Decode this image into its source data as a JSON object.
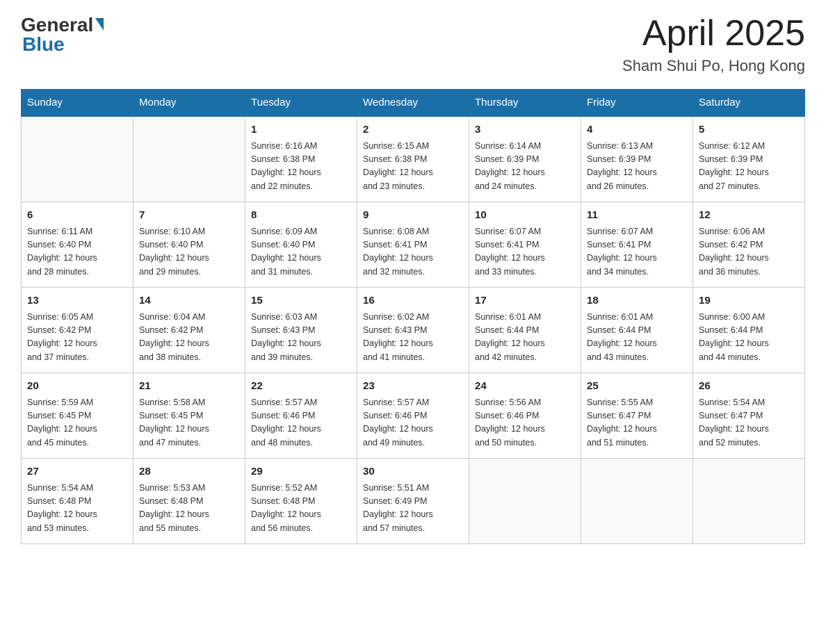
{
  "header": {
    "logo_general": "General",
    "logo_blue": "Blue",
    "title": "April 2025",
    "subtitle": "Sham Shui Po, Hong Kong"
  },
  "weekdays": [
    "Sunday",
    "Monday",
    "Tuesday",
    "Wednesday",
    "Thursday",
    "Friday",
    "Saturday"
  ],
  "weeks": [
    [
      {
        "day": "",
        "info": ""
      },
      {
        "day": "",
        "info": ""
      },
      {
        "day": "1",
        "info": "Sunrise: 6:16 AM\nSunset: 6:38 PM\nDaylight: 12 hours\nand 22 minutes."
      },
      {
        "day": "2",
        "info": "Sunrise: 6:15 AM\nSunset: 6:38 PM\nDaylight: 12 hours\nand 23 minutes."
      },
      {
        "day": "3",
        "info": "Sunrise: 6:14 AM\nSunset: 6:39 PM\nDaylight: 12 hours\nand 24 minutes."
      },
      {
        "day": "4",
        "info": "Sunrise: 6:13 AM\nSunset: 6:39 PM\nDaylight: 12 hours\nand 26 minutes."
      },
      {
        "day": "5",
        "info": "Sunrise: 6:12 AM\nSunset: 6:39 PM\nDaylight: 12 hours\nand 27 minutes."
      }
    ],
    [
      {
        "day": "6",
        "info": "Sunrise: 6:11 AM\nSunset: 6:40 PM\nDaylight: 12 hours\nand 28 minutes."
      },
      {
        "day": "7",
        "info": "Sunrise: 6:10 AM\nSunset: 6:40 PM\nDaylight: 12 hours\nand 29 minutes."
      },
      {
        "day": "8",
        "info": "Sunrise: 6:09 AM\nSunset: 6:40 PM\nDaylight: 12 hours\nand 31 minutes."
      },
      {
        "day": "9",
        "info": "Sunrise: 6:08 AM\nSunset: 6:41 PM\nDaylight: 12 hours\nand 32 minutes."
      },
      {
        "day": "10",
        "info": "Sunrise: 6:07 AM\nSunset: 6:41 PM\nDaylight: 12 hours\nand 33 minutes."
      },
      {
        "day": "11",
        "info": "Sunrise: 6:07 AM\nSunset: 6:41 PM\nDaylight: 12 hours\nand 34 minutes."
      },
      {
        "day": "12",
        "info": "Sunrise: 6:06 AM\nSunset: 6:42 PM\nDaylight: 12 hours\nand 36 minutes."
      }
    ],
    [
      {
        "day": "13",
        "info": "Sunrise: 6:05 AM\nSunset: 6:42 PM\nDaylight: 12 hours\nand 37 minutes."
      },
      {
        "day": "14",
        "info": "Sunrise: 6:04 AM\nSunset: 6:42 PM\nDaylight: 12 hours\nand 38 minutes."
      },
      {
        "day": "15",
        "info": "Sunrise: 6:03 AM\nSunset: 6:43 PM\nDaylight: 12 hours\nand 39 minutes."
      },
      {
        "day": "16",
        "info": "Sunrise: 6:02 AM\nSunset: 6:43 PM\nDaylight: 12 hours\nand 41 minutes."
      },
      {
        "day": "17",
        "info": "Sunrise: 6:01 AM\nSunset: 6:44 PM\nDaylight: 12 hours\nand 42 minutes."
      },
      {
        "day": "18",
        "info": "Sunrise: 6:01 AM\nSunset: 6:44 PM\nDaylight: 12 hours\nand 43 minutes."
      },
      {
        "day": "19",
        "info": "Sunrise: 6:00 AM\nSunset: 6:44 PM\nDaylight: 12 hours\nand 44 minutes."
      }
    ],
    [
      {
        "day": "20",
        "info": "Sunrise: 5:59 AM\nSunset: 6:45 PM\nDaylight: 12 hours\nand 45 minutes."
      },
      {
        "day": "21",
        "info": "Sunrise: 5:58 AM\nSunset: 6:45 PM\nDaylight: 12 hours\nand 47 minutes."
      },
      {
        "day": "22",
        "info": "Sunrise: 5:57 AM\nSunset: 6:46 PM\nDaylight: 12 hours\nand 48 minutes."
      },
      {
        "day": "23",
        "info": "Sunrise: 5:57 AM\nSunset: 6:46 PM\nDaylight: 12 hours\nand 49 minutes."
      },
      {
        "day": "24",
        "info": "Sunrise: 5:56 AM\nSunset: 6:46 PM\nDaylight: 12 hours\nand 50 minutes."
      },
      {
        "day": "25",
        "info": "Sunrise: 5:55 AM\nSunset: 6:47 PM\nDaylight: 12 hours\nand 51 minutes."
      },
      {
        "day": "26",
        "info": "Sunrise: 5:54 AM\nSunset: 6:47 PM\nDaylight: 12 hours\nand 52 minutes."
      }
    ],
    [
      {
        "day": "27",
        "info": "Sunrise: 5:54 AM\nSunset: 6:48 PM\nDaylight: 12 hours\nand 53 minutes."
      },
      {
        "day": "28",
        "info": "Sunrise: 5:53 AM\nSunset: 6:48 PM\nDaylight: 12 hours\nand 55 minutes."
      },
      {
        "day": "29",
        "info": "Sunrise: 5:52 AM\nSunset: 6:48 PM\nDaylight: 12 hours\nand 56 minutes."
      },
      {
        "day": "30",
        "info": "Sunrise: 5:51 AM\nSunset: 6:49 PM\nDaylight: 12 hours\nand 57 minutes."
      },
      {
        "day": "",
        "info": ""
      },
      {
        "day": "",
        "info": ""
      },
      {
        "day": "",
        "info": ""
      }
    ]
  ]
}
